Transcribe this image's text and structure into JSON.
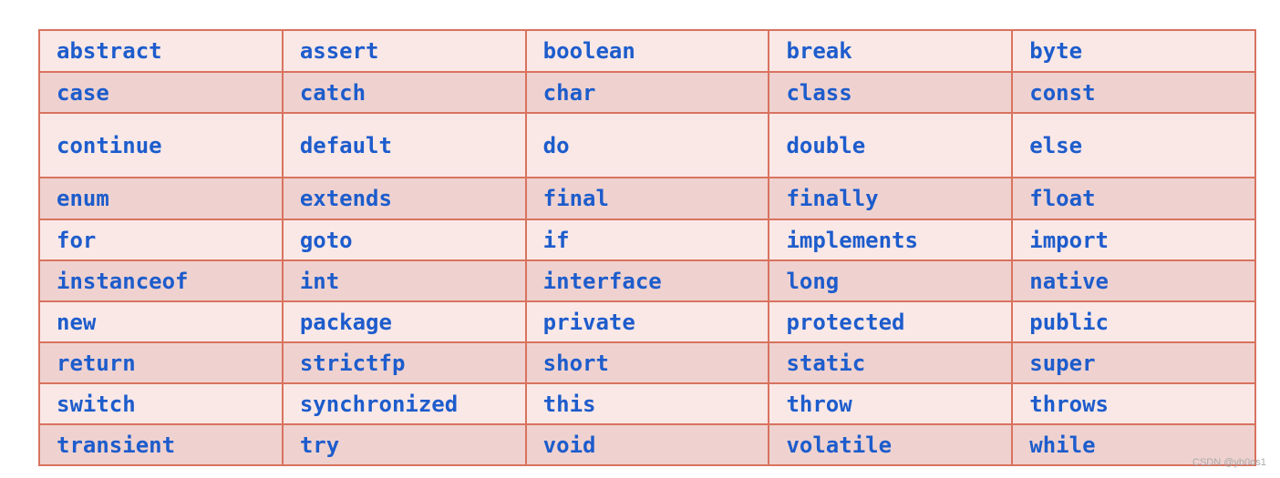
{
  "rows": [
    [
      "abstract",
      "assert",
      "boolean",
      "break",
      "byte"
    ],
    [
      "case",
      "catch",
      "char",
      "class",
      "const"
    ],
    [
      "continue",
      "default",
      "do",
      "double",
      "else"
    ],
    [
      "enum",
      "extends",
      "final",
      "finally",
      "float"
    ],
    [
      "for",
      "goto",
      "if",
      "implements",
      "import"
    ],
    [
      "instanceof",
      "int",
      "interface",
      "long",
      "native"
    ],
    [
      "new",
      "package",
      "private",
      "protected",
      "public"
    ],
    [
      "return",
      "strictfp",
      "short",
      "static",
      "super"
    ],
    [
      "switch",
      "synchronized",
      "this",
      "throw",
      "throws"
    ],
    [
      "transient",
      "try",
      "void",
      "volatile",
      "while"
    ]
  ],
  "watermark": "CSDN @yb0os1",
  "colors": {
    "text": "#1d5ccc",
    "border": "#d8735f",
    "row_light": "#fae8e6",
    "row_dark": "#efd2cf"
  }
}
